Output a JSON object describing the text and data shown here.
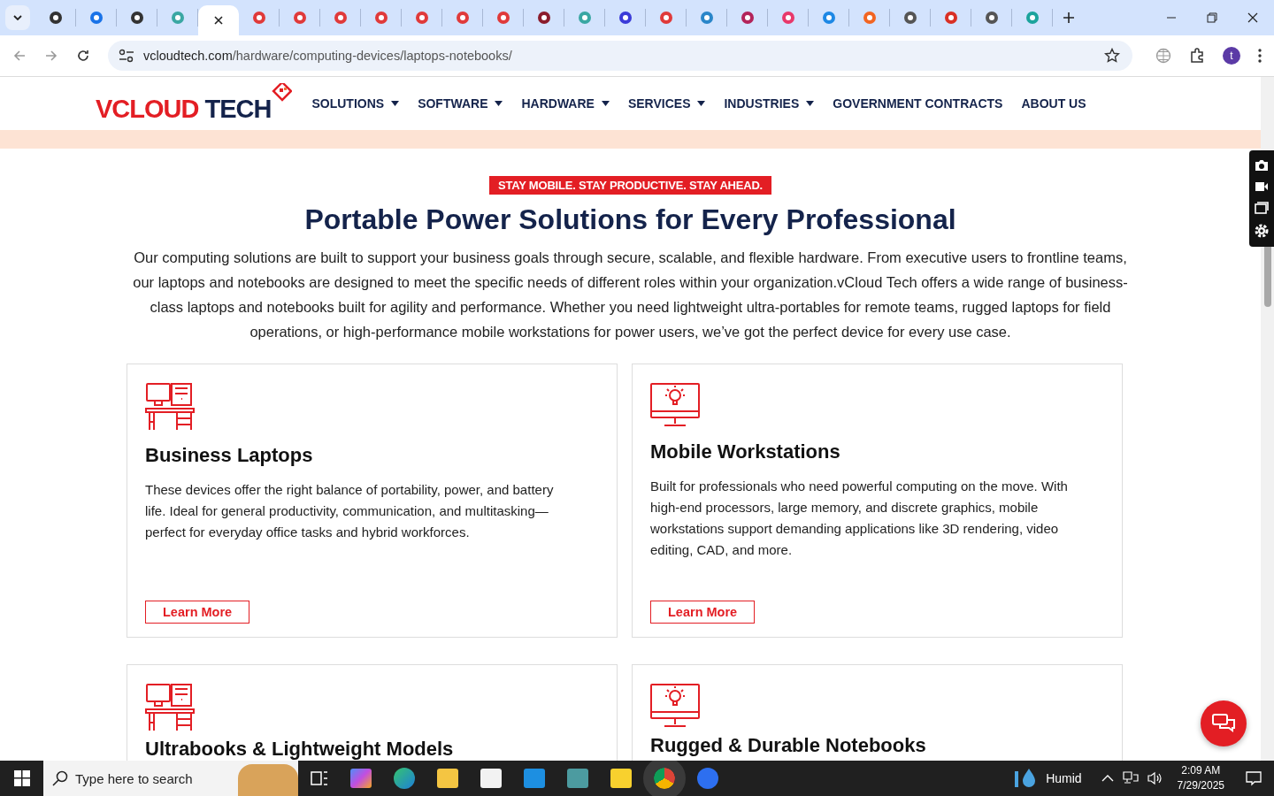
{
  "browser": {
    "tabs": [
      {
        "selected": false
      },
      {
        "selected": false
      },
      {
        "selected": false
      },
      {
        "selected": false
      },
      {
        "selected": true
      },
      {
        "selected": false
      },
      {
        "selected": false
      },
      {
        "selected": false
      },
      {
        "selected": false
      },
      {
        "selected": false
      },
      {
        "selected": false
      },
      {
        "selected": false
      },
      {
        "selected": false
      },
      {
        "selected": false
      },
      {
        "selected": false
      },
      {
        "selected": false
      },
      {
        "selected": false
      },
      {
        "selected": false
      },
      {
        "selected": false
      },
      {
        "selected": false
      },
      {
        "selected": false
      },
      {
        "selected": false
      },
      {
        "selected": false
      },
      {
        "selected": false
      },
      {
        "selected": false
      }
    ],
    "url_domain": "vcloudtech.com",
    "url_path": "/hardware/computing-devices/laptops-notebooks/",
    "profile_initial": "t"
  },
  "site": {
    "logo_part1": "VCLOUD",
    "logo_part2": "TECH",
    "nav": [
      {
        "label": "SOLUTIONS",
        "dropdown": true
      },
      {
        "label": "SOFTWARE",
        "dropdown": true
      },
      {
        "label": "HARDWARE",
        "dropdown": true
      },
      {
        "label": "SERVICES",
        "dropdown": true
      },
      {
        "label": "INDUSTRIES",
        "dropdown": true
      },
      {
        "label": "GOVERNMENT CONTRACTS",
        "dropdown": false
      },
      {
        "label": "ABOUT US",
        "dropdown": false
      }
    ]
  },
  "hero": {
    "badge": "STAY MOBILE. STAY PRODUCTIVE. STAY AHEAD.",
    "heading": "Portable Power Solutions for Every Professional",
    "intro": "Our computing solutions are built to support your business goals through secure, scalable, and flexible hardware. From executive users to frontline teams, our laptops and notebooks are designed to meet the specific needs of different roles within your organization.vCloud Tech offers a wide range of business-class laptops and notebooks built for agility and performance. Whether you need lightweight ultra-portables for remote teams, rugged laptops for field operations, or high-performance mobile workstations for power users, we’ve got the perfect device for every use case."
  },
  "cards": [
    {
      "kind": "desk",
      "title": "Business Laptops",
      "text": "These devices offer the right balance of portability, power, and battery life. Ideal for general productivity, communication, and multitasking—perfect for everyday office tasks and hybrid workforces.",
      "button": "Learn More"
    },
    {
      "kind": "monitor",
      "title": "Mobile Workstations",
      "text": "Built for professionals who need powerful computing on the move. With high-end processors, large memory, and discrete graphics, mobile workstations support demanding applications like 3D rendering, video editing, CAD, and more.",
      "button": "Learn More"
    },
    {
      "kind": "desk",
      "title": "Ultrabooks & Lightweight Models"
    },
    {
      "kind": "monitor",
      "title": "Rugged & Durable Notebooks"
    }
  ],
  "taskbar": {
    "search_placeholder": "Type here to search",
    "weather": "Humid",
    "time": "2:09 AM",
    "date": "7/29/2025"
  }
}
